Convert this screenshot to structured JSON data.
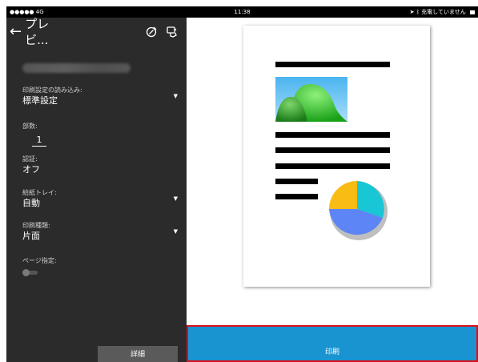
{
  "status_bar": {
    "carrier": "●●●●● 4G",
    "time": "11:38",
    "charging_text": "充電していません"
  },
  "header": {
    "back_icon": "arrow-left-icon",
    "title": "プレビ...",
    "icons": [
      "printer-settings-icon",
      "nfc-touch-icon"
    ]
  },
  "settings": {
    "preset": {
      "label": "印刷設定の読み込み:",
      "value": "標準設定"
    },
    "copies": {
      "label": "部数:",
      "value": "1"
    },
    "auth": {
      "label": "認証:",
      "value": "オフ"
    },
    "tray": {
      "label": "給紙トレイ:",
      "value": "自動"
    },
    "print_type": {
      "label": "印刷種類:",
      "value": "片面"
    },
    "page_range": {
      "label": "ページ指定:",
      "enabled": false
    },
    "dropdown_icon": "triangle-down-icon"
  },
  "buttons": {
    "details": "詳細",
    "print": "印刷"
  },
  "colors": {
    "sidebar_bg": "#2b2b2b",
    "print_button": "#1a94d1",
    "highlight_border": "#d90f1b"
  }
}
